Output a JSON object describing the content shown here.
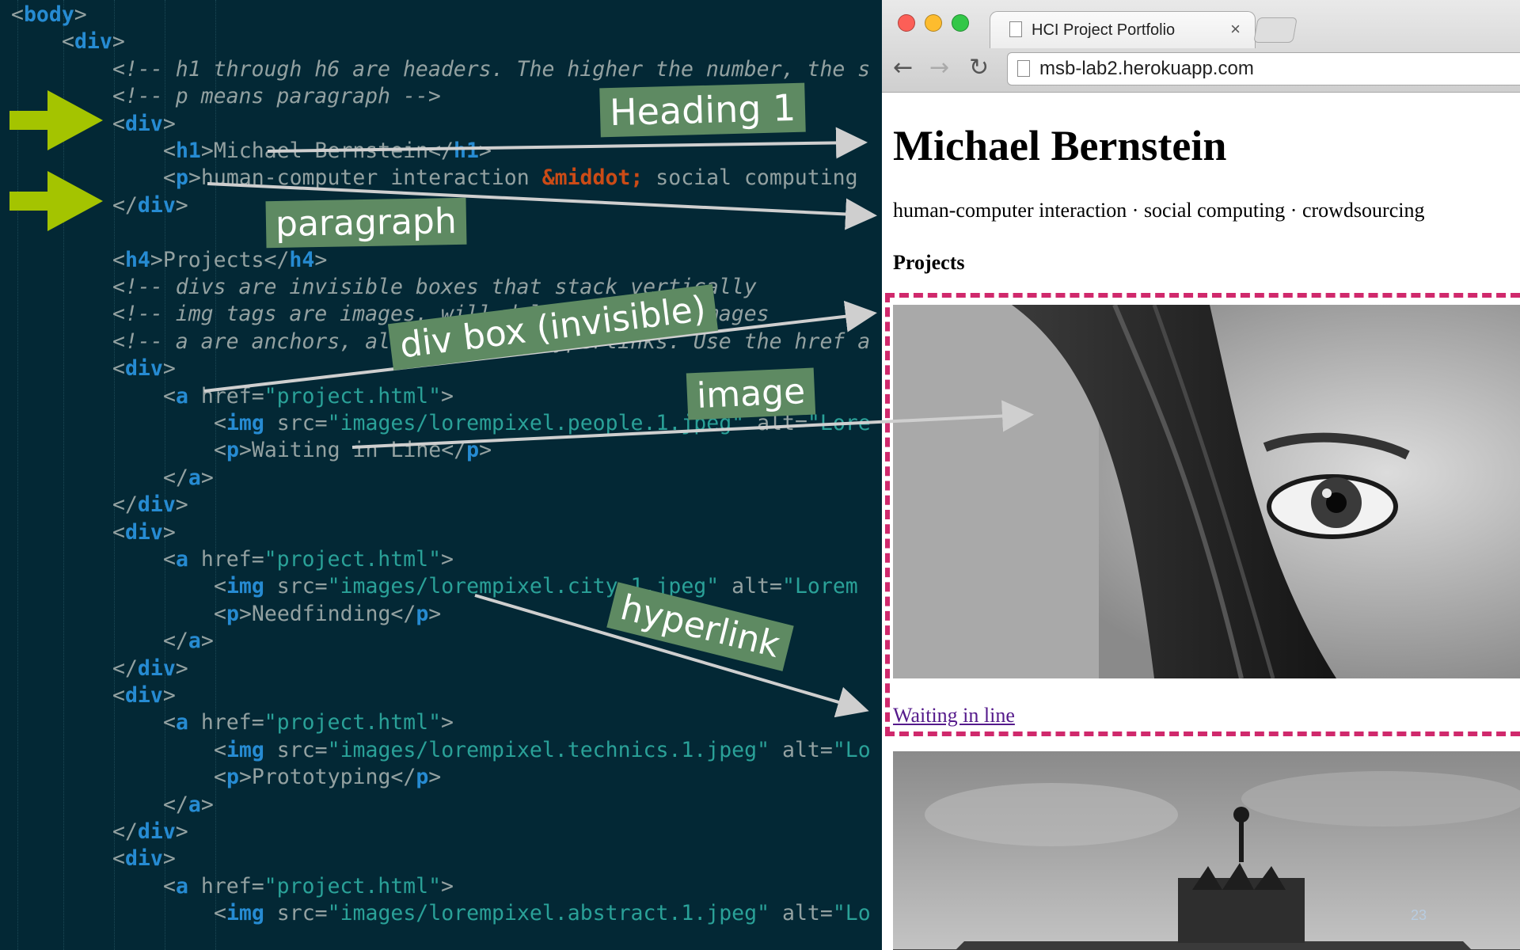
{
  "editor": {
    "lines": [
      {
        "tokens": [
          [
            "br",
            "<"
          ],
          [
            "tag",
            "body"
          ],
          [
            "br",
            ">"
          ]
        ]
      },
      {
        "tokens": [
          [
            "br",
            "<"
          ],
          [
            "tag",
            "div"
          ],
          [
            "br",
            ">"
          ]
        ]
      },
      {
        "tokens": [
          [
            "cm",
            "<!-- h1 through h6 are headers. The higher the number, the s"
          ]
        ]
      },
      {
        "tokens": [
          [
            "cm",
            "<!-- p means paragraph -->"
          ]
        ]
      },
      {
        "tokens": [
          [
            "br",
            "<"
          ],
          [
            "tag",
            "div"
          ],
          [
            "br",
            ">"
          ]
        ]
      },
      {
        "tokens": [
          [
            "br",
            "<"
          ],
          [
            "tag",
            "h1"
          ],
          [
            "br",
            ">"
          ],
          [
            "txt",
            "Michael Bernstein"
          ],
          [
            "br",
            "</"
          ],
          [
            "tag",
            "h1"
          ],
          [
            "br",
            ">"
          ]
        ]
      },
      {
        "tokens": [
          [
            "br",
            "<"
          ],
          [
            "tag",
            "p"
          ],
          [
            "br",
            ">"
          ],
          [
            "txt",
            "human-computer interaction "
          ],
          [
            "ent",
            "&middot;"
          ],
          [
            "txt",
            " social computing"
          ]
        ]
      },
      {
        "tokens": [
          [
            "br",
            "</"
          ],
          [
            "tag",
            "div"
          ],
          [
            "br",
            ">"
          ]
        ]
      },
      {
        "tokens": []
      },
      {
        "tokens": [
          [
            "br",
            "<"
          ],
          [
            "tag",
            "h4"
          ],
          [
            "br",
            ">"
          ],
          [
            "txt",
            "Projects"
          ],
          [
            "br",
            "</"
          ],
          [
            "tag",
            "h4"
          ],
          [
            "br",
            ">"
          ]
        ]
      },
      {
        "tokens": [
          [
            "cm",
            "<!-- divs are invisible boxes that stack vertically"
          ]
        ]
      },
      {
        "tokens": [
          [
            "cm",
            "<!-- img tags are images. will deliver random images"
          ]
        ]
      },
      {
        "tokens": [
          [
            "cm",
            "<!-- a are anchors, also known as hyperlinks. Use the href a"
          ]
        ]
      },
      {
        "tokens": [
          [
            "br",
            "<"
          ],
          [
            "tag",
            "div"
          ],
          [
            "br",
            ">"
          ]
        ]
      },
      {
        "tokens": [
          [
            "br",
            "<"
          ],
          [
            "tag",
            "a"
          ],
          [
            "attr",
            " href="
          ],
          [
            "str",
            "\"project.html\""
          ],
          [
            "br",
            ">"
          ]
        ]
      },
      {
        "tokens": [
          [
            "br",
            "<"
          ],
          [
            "tag",
            "img"
          ],
          [
            "attr",
            " src="
          ],
          [
            "str",
            "\"images/lorempixel.people.1.jpeg\""
          ],
          [
            "attr",
            " alt="
          ],
          [
            "str",
            "\"Lore"
          ]
        ]
      },
      {
        "tokens": [
          [
            "br",
            "<"
          ],
          [
            "tag",
            "p"
          ],
          [
            "br",
            ">"
          ],
          [
            "txt",
            "Waiting in Line"
          ],
          [
            "br",
            "</"
          ],
          [
            "tag",
            "p"
          ],
          [
            "br",
            ">"
          ]
        ]
      },
      {
        "tokens": [
          [
            "br",
            "</"
          ],
          [
            "tag",
            "a"
          ],
          [
            "br",
            ">"
          ]
        ]
      },
      {
        "tokens": [
          [
            "br",
            "</"
          ],
          [
            "tag",
            "div"
          ],
          [
            "br",
            ">"
          ]
        ]
      },
      {
        "tokens": [
          [
            "br",
            "<"
          ],
          [
            "tag",
            "div"
          ],
          [
            "br",
            ">"
          ]
        ]
      },
      {
        "tokens": [
          [
            "br",
            "<"
          ],
          [
            "tag",
            "a"
          ],
          [
            "attr",
            " href="
          ],
          [
            "str",
            "\"project.html\""
          ],
          [
            "br",
            ">"
          ]
        ]
      },
      {
        "tokens": [
          [
            "br",
            "<"
          ],
          [
            "tag",
            "img"
          ],
          [
            "attr",
            " src="
          ],
          [
            "str",
            "\"images/lorempixel.city.1.jpeg\""
          ],
          [
            "attr",
            " alt="
          ],
          [
            "str",
            "\"Lorem"
          ]
        ]
      },
      {
        "tokens": [
          [
            "br",
            "<"
          ],
          [
            "tag",
            "p"
          ],
          [
            "br",
            ">"
          ],
          [
            "txt",
            "Needfinding"
          ],
          [
            "br",
            "</"
          ],
          [
            "tag",
            "p"
          ],
          [
            "br",
            ">"
          ]
        ]
      },
      {
        "tokens": [
          [
            "br",
            "</"
          ],
          [
            "tag",
            "a"
          ],
          [
            "br",
            ">"
          ]
        ]
      },
      {
        "tokens": [
          [
            "br",
            "</"
          ],
          [
            "tag",
            "div"
          ],
          [
            "br",
            ">"
          ]
        ]
      },
      {
        "tokens": [
          [
            "br",
            "<"
          ],
          [
            "tag",
            "div"
          ],
          [
            "br",
            ">"
          ]
        ]
      },
      {
        "tokens": [
          [
            "br",
            "<"
          ],
          [
            "tag",
            "a"
          ],
          [
            "attr",
            " href="
          ],
          [
            "str",
            "\"project.html\""
          ],
          [
            "br",
            ">"
          ]
        ]
      },
      {
        "tokens": [
          [
            "br",
            "<"
          ],
          [
            "tag",
            "img"
          ],
          [
            "attr",
            " src="
          ],
          [
            "str",
            "\"images/lorempixel.technics.1.jpeg\""
          ],
          [
            "attr",
            " alt="
          ],
          [
            "str",
            "\"Lo"
          ]
        ]
      },
      {
        "tokens": [
          [
            "br",
            "<"
          ],
          [
            "tag",
            "p"
          ],
          [
            "br",
            ">"
          ],
          [
            "txt",
            "Prototyping"
          ],
          [
            "br",
            "</"
          ],
          [
            "tag",
            "p"
          ],
          [
            "br",
            ">"
          ]
        ]
      },
      {
        "tokens": [
          [
            "br",
            "</"
          ],
          [
            "tag",
            "a"
          ],
          [
            "br",
            ">"
          ]
        ]
      },
      {
        "tokens": [
          [
            "br",
            "</"
          ],
          [
            "tag",
            "div"
          ],
          [
            "br",
            ">"
          ]
        ]
      },
      {
        "tokens": [
          [
            "br",
            "<"
          ],
          [
            "tag",
            "div"
          ],
          [
            "br",
            ">"
          ]
        ]
      },
      {
        "tokens": [
          [
            "br",
            "<"
          ],
          [
            "tag",
            "a"
          ],
          [
            "attr",
            " href="
          ],
          [
            "str",
            "\"project.html\""
          ],
          [
            "br",
            ">"
          ]
        ]
      },
      {
        "tokens": [
          [
            "br",
            "<"
          ],
          [
            "tag",
            "img"
          ],
          [
            "attr",
            " src="
          ],
          [
            "str",
            "\"images/lorempixel.abstract.1.jpeg\""
          ],
          [
            "attr",
            " alt="
          ],
          [
            "str",
            "\"Lo"
          ]
        ]
      }
    ]
  },
  "browser": {
    "tab_title": "HCI Project Portfolio",
    "tab_close": "×",
    "url": "msb-lab2.herokuapp.com",
    "page": {
      "heading": "Michael Bernstein",
      "subtitle": "human-computer interaction · social computing · crowdsourcing",
      "projects_heading": "Projects",
      "first_link": "Waiting in line"
    }
  },
  "annotations": {
    "heading": "Heading 1",
    "paragraph": "paragraph",
    "div_box": "div box (invisible)",
    "image": "image",
    "hyperlink": "hyperlink"
  },
  "colors": {
    "editor_bg": "#032835",
    "tag": "#268bd2",
    "string": "#2aa198",
    "entity": "#cb4b16",
    "annotation_bg": "#5e8a62",
    "div_outline": "#d0296c",
    "pointer_arrow": "#a4c400"
  },
  "slide_number": "23"
}
